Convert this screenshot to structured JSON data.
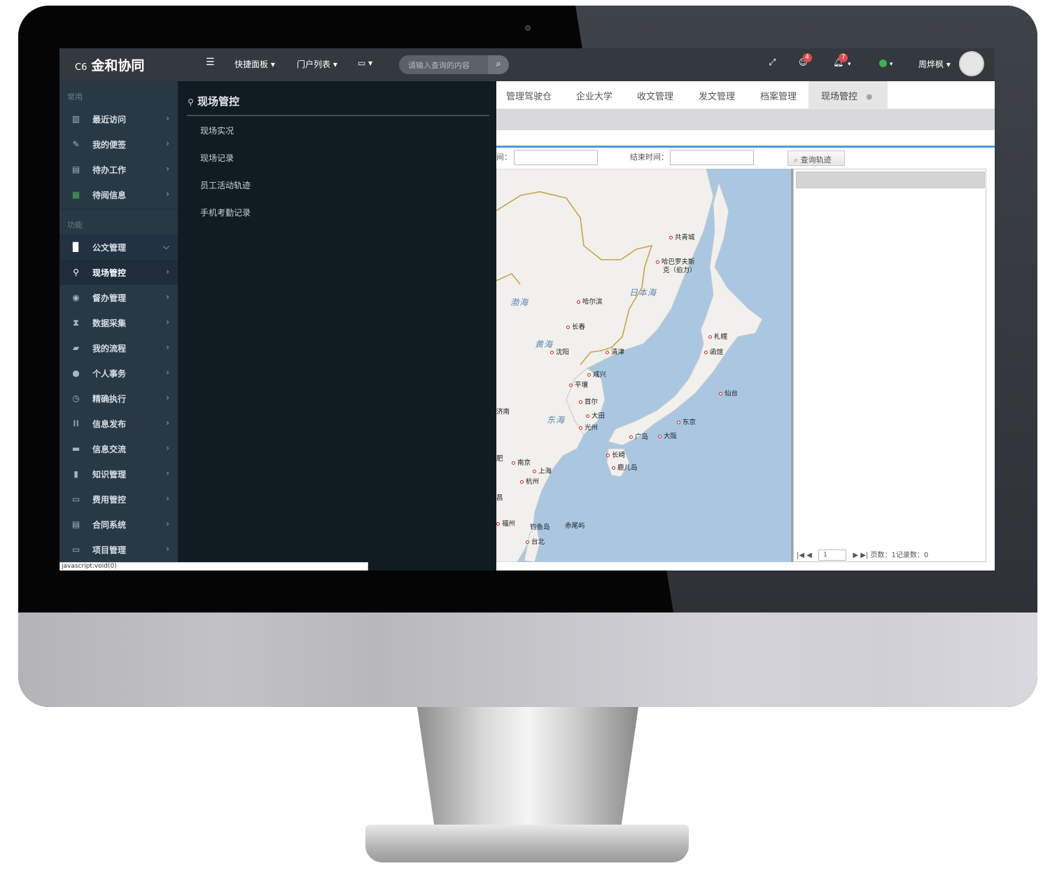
{
  "app": {
    "logo_prefix": "C6",
    "logo_name": "金和协同"
  },
  "topbar": {
    "menu_toggle_icon": "list-indent-icon",
    "quick_panel": "快捷面板 ▾",
    "portal_list": "门户列表 ▾",
    "device_menu": "▾",
    "search_placeholder": "请输入查询的内容",
    "badge_users": "4",
    "badge_bell": "7",
    "user_name": "周烨枫 ▾"
  },
  "sidebar": {
    "section_common": "常用",
    "common_items": [
      {
        "label": "最近访问",
        "icon": "bar-chart-icon"
      },
      {
        "label": "我的便签",
        "icon": "pencil-icon"
      },
      {
        "label": "待办工作",
        "icon": "list-icon"
      },
      {
        "label": "待阅信息",
        "icon": "grid-icon"
      }
    ],
    "section_function": "功能",
    "function_items": [
      {
        "label": "公文管理",
        "icon": "doc-icon"
      },
      {
        "label": "现场管控",
        "icon": "map-marker-icon"
      },
      {
        "label": "督办管理",
        "icon": "eye-icon"
      },
      {
        "label": "数据采集",
        "icon": "hourglass-icon"
      },
      {
        "label": "我的流程",
        "icon": "folder-icon"
      },
      {
        "label": "个人事务",
        "icon": "user-icon"
      },
      {
        "label": "精确执行",
        "icon": "clock-icon"
      },
      {
        "label": "信息发布",
        "icon": "apps-icon"
      },
      {
        "label": "信息交流",
        "icon": "chat-icon"
      },
      {
        "label": "知识管理",
        "icon": "bookmark-icon"
      },
      {
        "label": "费用管控",
        "icon": "card-icon"
      },
      {
        "label": "合同系统",
        "icon": "contract-icon"
      },
      {
        "label": "项目管理",
        "icon": "project-icon"
      }
    ]
  },
  "submenu": {
    "title": "现场管控",
    "links": [
      "现场实况",
      "现场记录",
      "员工活动轨迹",
      "手机考勤记录"
    ]
  },
  "statusbar": {
    "link_hint": "javascript:void(0)"
  },
  "tabs": [
    {
      "label": "管理驾驶仓"
    },
    {
      "label": "企业大学"
    },
    {
      "label": "收文管理"
    },
    {
      "label": "发文管理"
    },
    {
      "label": "档案管理"
    },
    {
      "label": "现场管控"
    }
  ],
  "filter": {
    "start_label": "间：",
    "end_label": "结束时间：",
    "query_button": "查询轨迹"
  },
  "map": {
    "cities": [
      {
        "name": "共青城"
      },
      {
        "name": "哈巴罗夫斯"
      },
      {
        "name": "克（伯力）"
      },
      {
        "name": "哈尔滨"
      },
      {
        "name": "长春"
      },
      {
        "name": "札幌"
      },
      {
        "name": "沈阳"
      },
      {
        "name": "清津"
      },
      {
        "name": "函馆"
      },
      {
        "name": "咸兴"
      },
      {
        "name": "平壤"
      },
      {
        "name": "首尔"
      },
      {
        "name": "仙台"
      },
      {
        "name": "济南"
      },
      {
        "name": "大田"
      },
      {
        "name": "东京"
      },
      {
        "name": "光州"
      },
      {
        "name": "广岛"
      },
      {
        "name": "大阪"
      },
      {
        "name": "长崎"
      },
      {
        "name": "南京"
      },
      {
        "name": "鹿儿岛"
      },
      {
        "name": "上海"
      },
      {
        "name": "杭州"
      },
      {
        "name": "福州"
      },
      {
        "name": "钓鱼岛"
      },
      {
        "name": "赤尾屿"
      },
      {
        "name": "台北"
      },
      {
        "name": "肥"
      },
      {
        "name": "昌"
      }
    ],
    "seas": [
      "渤海",
      "日本海",
      "黄海",
      "东海"
    ]
  },
  "pager": {
    "page": "1",
    "info": "页数：1记录数：0"
  }
}
